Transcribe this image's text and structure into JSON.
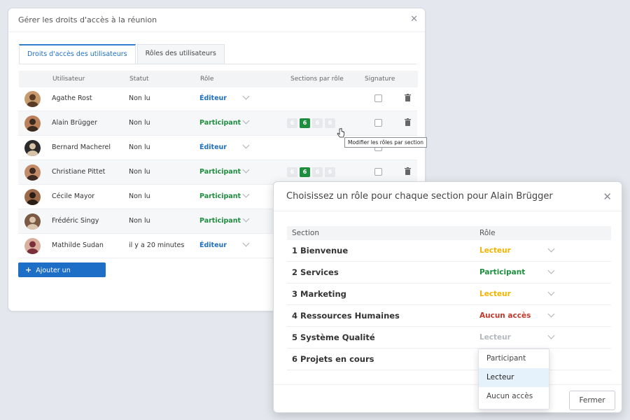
{
  "main_dialog": {
    "title": "Gérer les droits d'accès à la réunion",
    "tabs": [
      {
        "label": "Droits d'accès des utilisateurs",
        "active": true
      },
      {
        "label": "Rôles des utilisateurs",
        "active": false
      }
    ],
    "columns": [
      "Utilisateur",
      "Statut",
      "Rôle",
      "Sections par rôle",
      "Signature"
    ],
    "rows": [
      {
        "name": "Agathe Rost",
        "status": "Non lu",
        "role": "Éditeur",
        "role_color": "#1f6fc2",
        "sections": null
      },
      {
        "name": "Alain Brügger",
        "status": "Non lu",
        "role": "Participant",
        "role_color": "#1e8e3e",
        "sections": [
          "6",
          "6",
          "6",
          "6"
        ]
      },
      {
        "name": "Bernard Macherel",
        "status": "Non lu",
        "role": "Éditeur",
        "role_color": "#1f6fc2",
        "sections": null
      },
      {
        "name": "Christiane Pittet",
        "status": "Non lu",
        "role": "Participant",
        "role_color": "#1e8e3e",
        "sections": [
          "6",
          "6",
          "6",
          "6"
        ]
      },
      {
        "name": "Cécile Mayor",
        "status": "Non lu",
        "role": "Participant",
        "role_color": "#1e8e3e",
        "sections": null
      },
      {
        "name": "Frédéric Singy",
        "status": "Non lu",
        "role": "Participant",
        "role_color": "#1e8e3e",
        "sections": null
      },
      {
        "name": "Mathilde Sudan",
        "status": "il y a 20 minutes",
        "role": "Éditeur",
        "role_color": "#1f6fc2",
        "sections": null
      }
    ],
    "add_user_button": "Ajouter un utilisateur",
    "tooltip": "Modifier les rôles par section"
  },
  "section_dialog": {
    "title": "Choisissez un rôle pour chaque section pour Alain Brügger",
    "columns": [
      "Section",
      "Rôle"
    ],
    "sections": [
      {
        "name": "1 Bienvenue",
        "role": "Lecteur",
        "color": "#f2b400"
      },
      {
        "name": "2 Services",
        "role": "Participant",
        "color": "#1e8e3e"
      },
      {
        "name": "3 Marketing",
        "role": "Lecteur",
        "color": "#f2b400"
      },
      {
        "name": "4 Ressources Humaines",
        "role": "Aucun accès",
        "color": "#c0392b"
      },
      {
        "name": "5 Système Qualité",
        "role": "Lecteur",
        "color": "#b3b8bf"
      },
      {
        "name": "6 Projets en cours",
        "role": "",
        "color": ""
      }
    ],
    "dropdown_options": [
      "Participant",
      "Lecteur",
      "Aucun accès"
    ],
    "dropdown_selected": "Lecteur",
    "close_button": "Fermer"
  }
}
